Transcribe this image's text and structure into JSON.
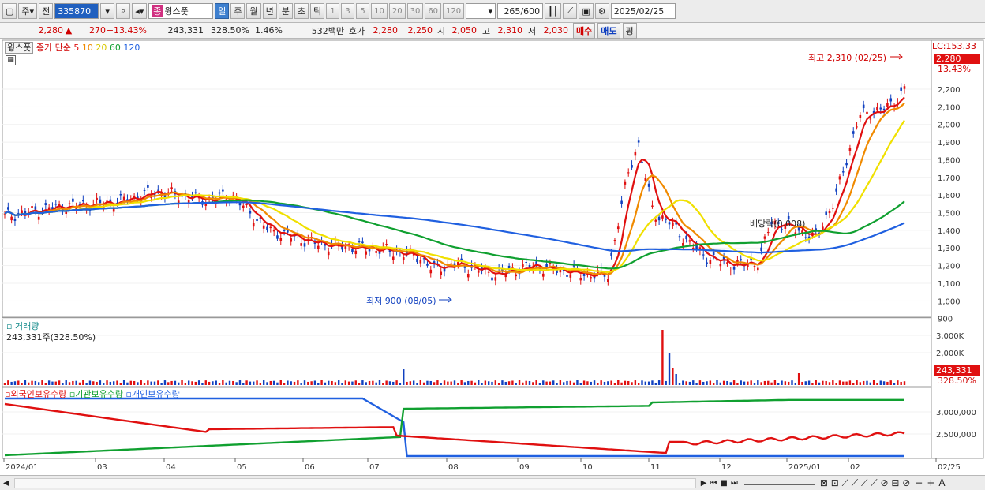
{
  "toolbar": {
    "type_sel": "주",
    "prev": "전",
    "code": "335870",
    "name_badge": "종",
    "name": "윙스풋",
    "periods": [
      "일",
      "주",
      "월",
      "년",
      "분",
      "초",
      "틱"
    ],
    "period_active": "일",
    "numbers": [
      "1",
      "3",
      "5",
      "10",
      "20",
      "30",
      "60",
      "120"
    ],
    "count": "265",
    "count_total": "/600",
    "date": "2025/02/25"
  },
  "quote": {
    "price": "2,280",
    "arrow": "▲",
    "change": "270",
    "change_pct": "+13.43%",
    "volume": "243,331",
    "vol_ratio": "328.50%",
    "turnover": "1.46%",
    "amount": "532백만",
    "hoga_label": "호가",
    "hoga1": "2,280",
    "hoga2": "2,250",
    "open_label": "시",
    "open": "2,050",
    "high_label": "고",
    "high": "2,310",
    "low_label": "저",
    "low": "2,030",
    "buy": "매수",
    "sell": "매도",
    "eval": "평"
  },
  "price_panel": {
    "stock": "윙스풋",
    "ma_label": "종가 단순",
    "ma": [
      {
        "period": "5",
        "color": "#e01010"
      },
      {
        "period": "10",
        "color": "#f08a00"
      },
      {
        "period": "20",
        "color": "#e8e000"
      },
      {
        "period": "60",
        "color": "#10a030"
      },
      {
        "period": "120",
        "color": "#2060e0"
      }
    ],
    "lc": "LC:153.33",
    "last_price": "2,280",
    "last_pct": "13.43%",
    "high_annot": "최고 2,310 (02/25)",
    "low_annot": "최저 900 (08/05)",
    "dividend": "배당락(0.008)",
    "yticks": [
      "2,200",
      "2,100",
      "2,000",
      "1,900",
      "1,800",
      "1,700",
      "1,600",
      "1,500",
      "1,400",
      "1,300",
      "1,200",
      "1,100",
      "1,000",
      "900"
    ]
  },
  "volume_panel": {
    "title": "거래량",
    "value": "243,331주(328.50%)",
    "yticks": [
      "3,000K",
      "2,000K"
    ],
    "last": "243,331",
    "last_pct": "328.50%"
  },
  "holding_panel": {
    "labels": [
      "외국인보유수량",
      "기관보유수량",
      "개인보유수량"
    ],
    "colors": [
      "#e01010",
      "#10a030",
      "#2060e0"
    ],
    "yticks": [
      "3,000,000",
      "2,500,000"
    ]
  },
  "xaxis": [
    "2024/01",
    "03",
    "04",
    "05",
    "06",
    "07",
    "08",
    "09",
    "10",
    "11",
    "12",
    "2025/01",
    "02",
    "02/25"
  ]
}
